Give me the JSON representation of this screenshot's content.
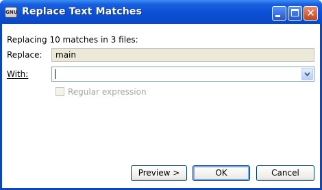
{
  "window": {
    "title": "Replace Text Matches",
    "app_icon_text": "GNU"
  },
  "dialog": {
    "summary": "Replacing 10 matches in 3 files:",
    "replace_label": "Replace:",
    "replace_value": "main",
    "with_label": "With:",
    "with_value": "",
    "regex_label": "Regular expression",
    "regex_checked": false,
    "regex_enabled": false
  },
  "buttons": {
    "preview": "Preview >",
    "ok": "OK",
    "cancel": "Cancel"
  },
  "colors": {
    "titlebar": "#0c4fd6",
    "close_button": "#c44421",
    "disabled_text": "#a7a69a",
    "readonly_bg": "#ece9d8"
  }
}
